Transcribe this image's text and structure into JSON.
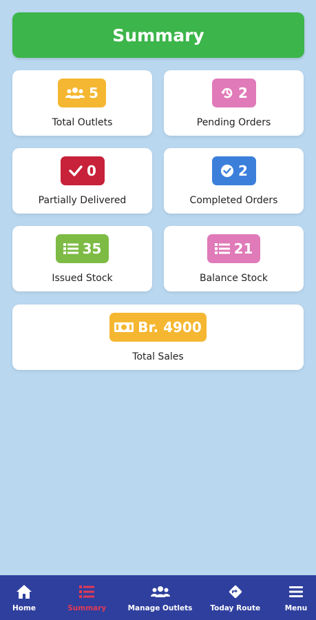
{
  "header": {
    "title": "Summary"
  },
  "cards": {
    "total_outlets": {
      "value": "5",
      "label": "Total Outlets",
      "color": "#f5b731",
      "icon": "users-icon"
    },
    "pending_orders": {
      "value": "2",
      "label": "Pending Orders",
      "color": "#e07ab8",
      "icon": "history-icon"
    },
    "partially_delivered": {
      "value": "0",
      "label": "Partially Delivered",
      "color": "#c8213a",
      "icon": "check-icon"
    },
    "completed_orders": {
      "value": "2",
      "label": "Completed Orders",
      "color": "#3b7fdb",
      "icon": "check-circle-icon"
    },
    "issued_stock": {
      "value": "35",
      "label": "Issued Stock",
      "color": "#7dbb45",
      "icon": "list-icon"
    },
    "balance_stock": {
      "value": "21",
      "label": "Balance Stock",
      "color": "#e07ab8",
      "icon": "list-icon"
    },
    "total_sales": {
      "value": "Br. 4900",
      "label": "Total Sales",
      "color": "#f5b731",
      "icon": "money-icon"
    }
  },
  "nav": {
    "home": {
      "label": "Home",
      "icon": "home-icon"
    },
    "summary": {
      "label": "Summary",
      "icon": "list-icon",
      "active": true,
      "active_color": "#e23a55"
    },
    "manage_outlets": {
      "label": "Manage Outlets",
      "icon": "users-icon"
    },
    "today_route": {
      "label": "Today Route",
      "icon": "route-diamond-icon"
    },
    "menu": {
      "label": "Menu",
      "icon": "hamburger-icon"
    }
  },
  "colors": {
    "background": "#b9d7ef",
    "header": "#3cb54a",
    "nav": "#2f3f9e"
  }
}
